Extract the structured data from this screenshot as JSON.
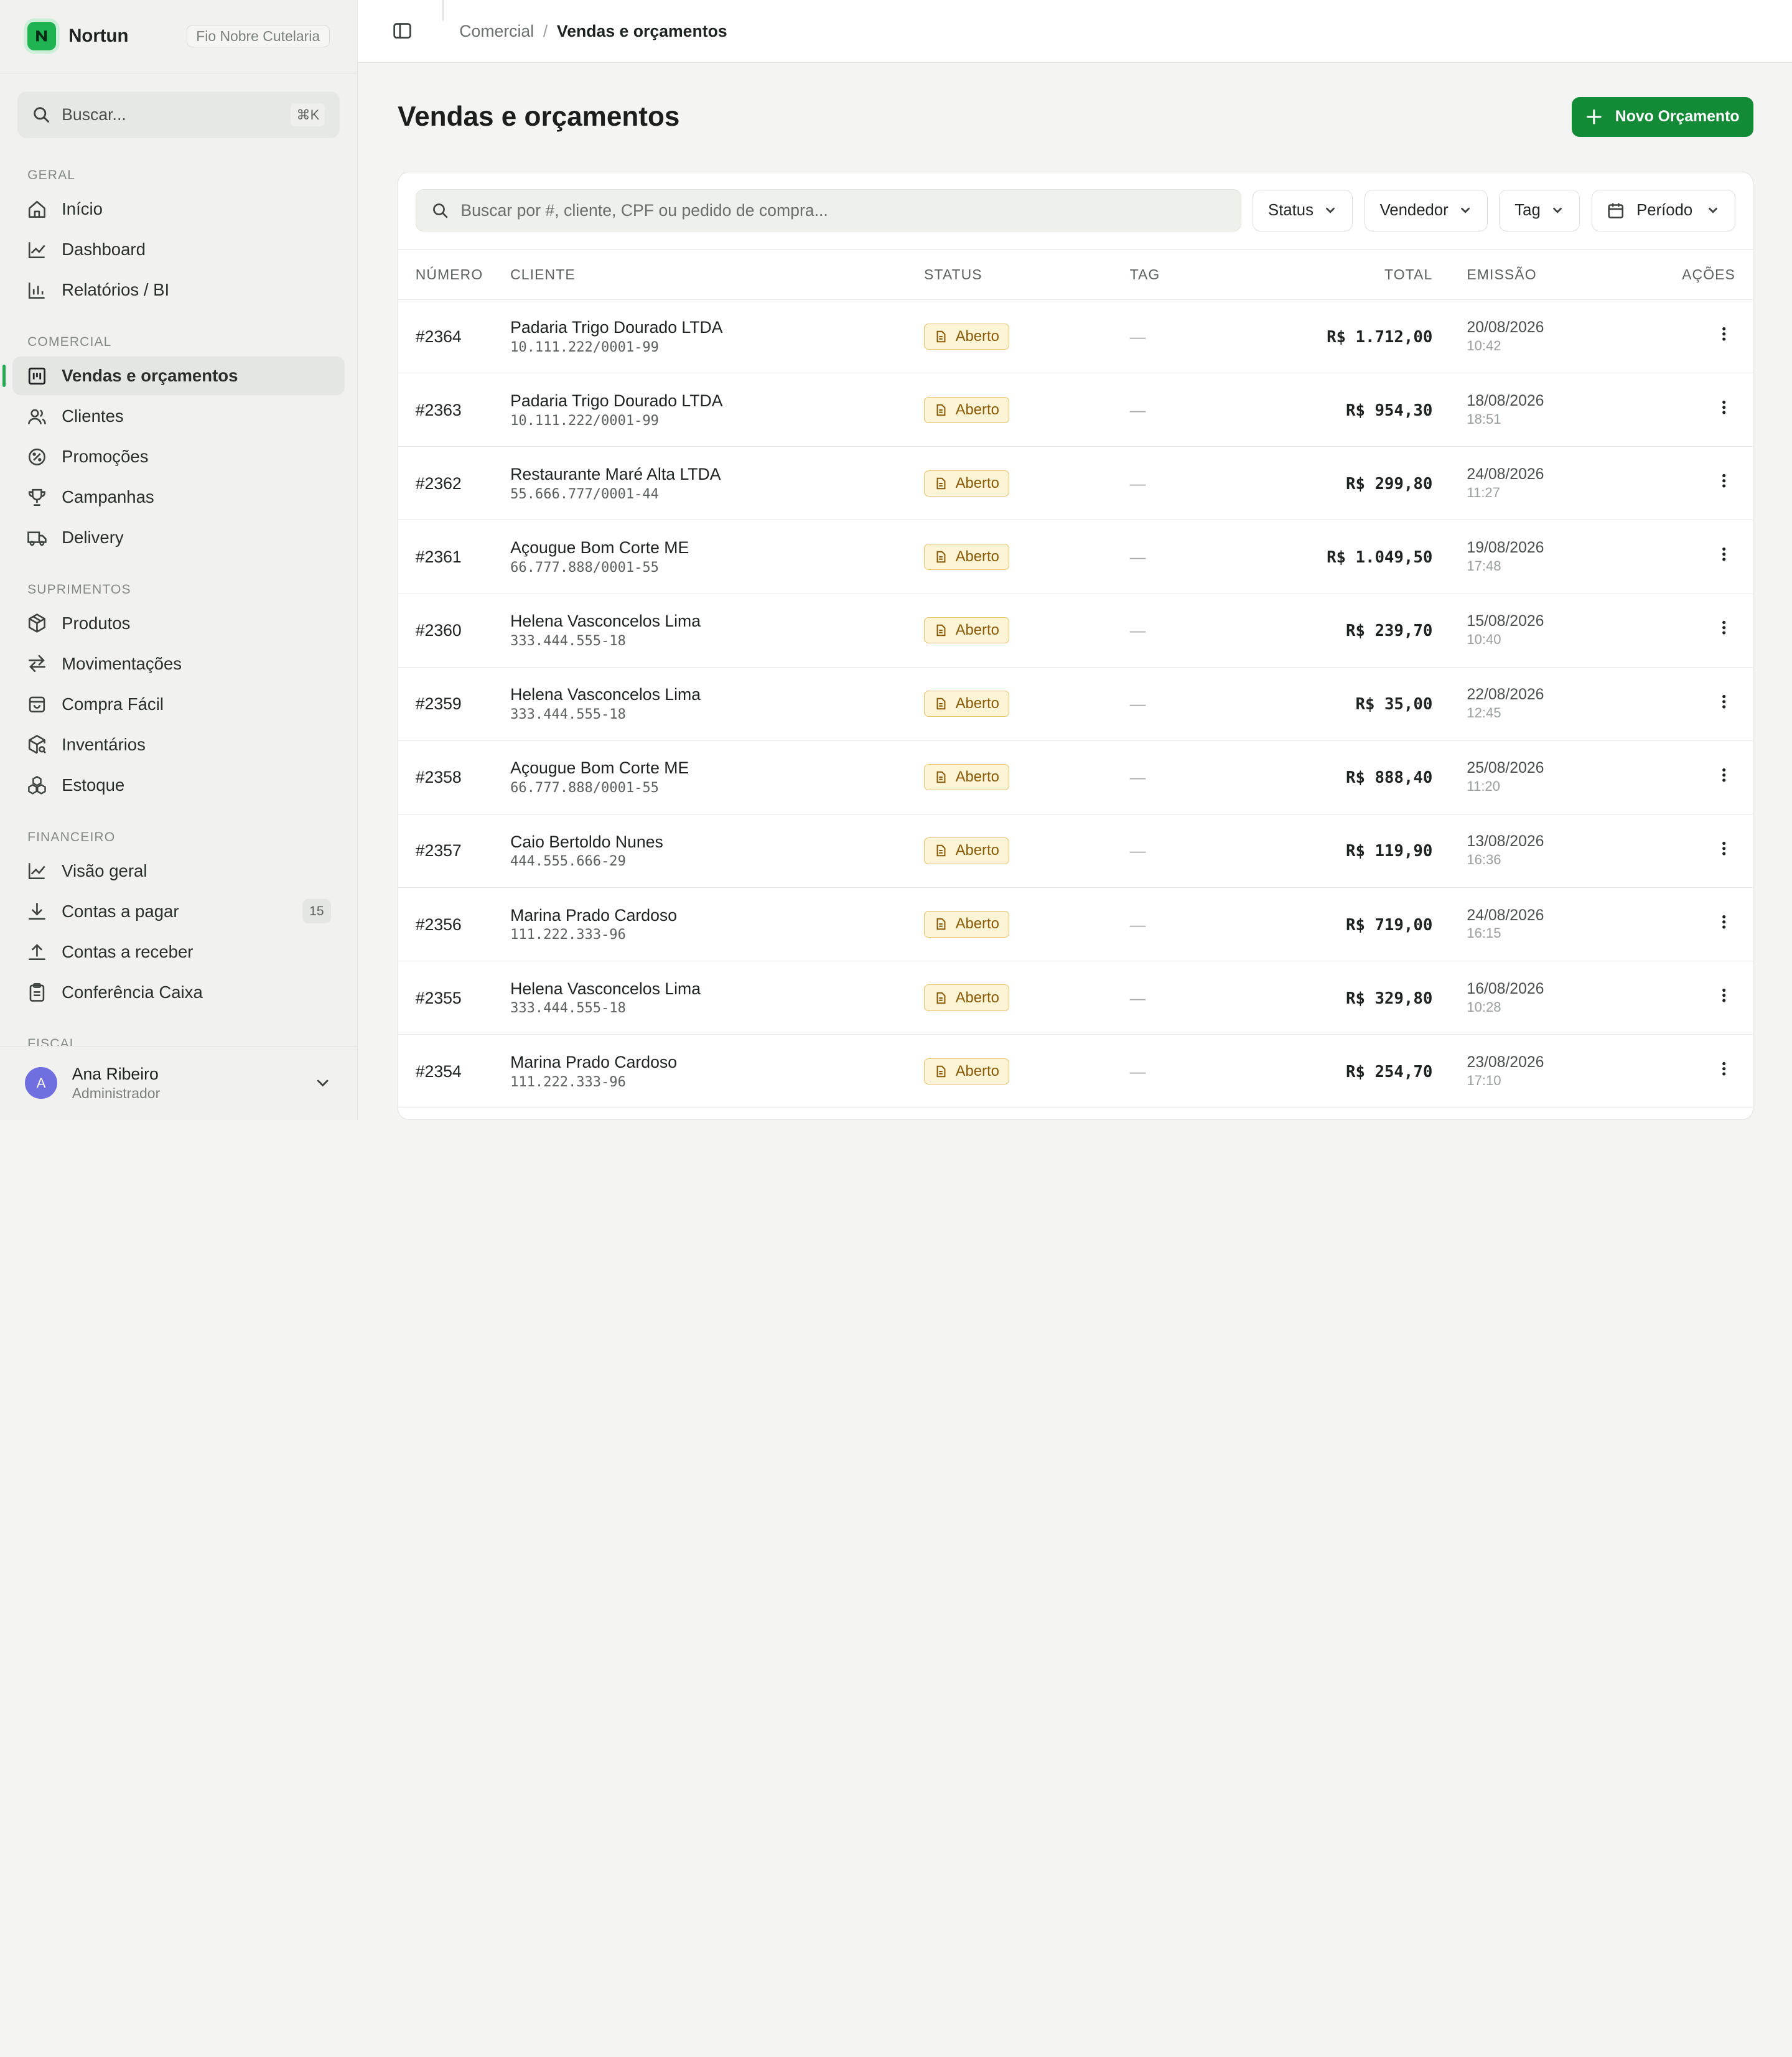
{
  "brand": {
    "name": "Nortun",
    "org": "Fio Nobre Cutelaria"
  },
  "search": {
    "placeholder": "Buscar...",
    "shortcut": "⌘K"
  },
  "nav": {
    "sections": {
      "geral": "GERAL",
      "comercial": "COMERCIAL",
      "suprimentos": "SUPRIMENTOS",
      "financeiro": "FINANCEIRO",
      "fiscal": "FISCAL"
    },
    "items": {
      "inicio": "Início",
      "dashboard": "Dashboard",
      "relatorios": "Relatórios / BI",
      "vendas": "Vendas e orçamentos",
      "clientes": "Clientes",
      "promocoes": "Promoções",
      "campanhas": "Campanhas",
      "delivery": "Delivery",
      "produtos": "Produtos",
      "movimentacoes": "Movimentações",
      "compra_facil": "Compra Fácil",
      "inventarios": "Inventários",
      "estoque": "Estoque",
      "visao_geral": "Visão geral",
      "contas_pagar": "Contas a pagar",
      "contas_pagar_count": "15",
      "contas_receber": "Contas a receber",
      "conferencia_caixa": "Conferência Caixa"
    }
  },
  "user": {
    "initial": "A",
    "name": "Ana Ribeiro",
    "role": "Administrador"
  },
  "breadcrumb": {
    "parent": "Comercial",
    "separator": "/",
    "current": "Vendas e orçamentos"
  },
  "page": {
    "title": "Vendas e orçamentos",
    "new_button": "Novo Orçamento"
  },
  "filters": {
    "search_placeholder": "Buscar por #, cliente, CPF ou pedido de compra...",
    "status": "Status",
    "vendedor": "Vendedor",
    "tag": "Tag",
    "periodo": "Período"
  },
  "table": {
    "headers": {
      "numero": "NÚMERO",
      "cliente": "CLIENTE",
      "status": "STATUS",
      "tag": "TAG",
      "total": "TOTAL",
      "emissao": "EMISSÃO",
      "acoes": "AÇÕES"
    },
    "rows": [
      {
        "num": "#2364",
        "client": "Padaria Trigo Dourado LTDA",
        "doc": "10.111.222/0001-99",
        "status": "Aberto",
        "tag": "—",
        "total": "R$ 1.712,00",
        "date": "20/08/2026",
        "time": "10:42"
      },
      {
        "num": "#2363",
        "client": "Padaria Trigo Dourado LTDA",
        "doc": "10.111.222/0001-99",
        "status": "Aberto",
        "tag": "—",
        "total": "R$ 954,30",
        "date": "18/08/2026",
        "time": "18:51"
      },
      {
        "num": "#2362",
        "client": "Restaurante Maré Alta LTDA",
        "doc": "55.666.777/0001-44",
        "status": "Aberto",
        "tag": "—",
        "total": "R$ 299,80",
        "date": "24/08/2026",
        "time": "11:27"
      },
      {
        "num": "#2361",
        "client": "Açougue Bom Corte ME",
        "doc": "66.777.888/0001-55",
        "status": "Aberto",
        "tag": "—",
        "total": "R$ 1.049,50",
        "date": "19/08/2026",
        "time": "17:48"
      },
      {
        "num": "#2360",
        "client": "Helena Vasconcelos Lima",
        "doc": "333.444.555-18",
        "status": "Aberto",
        "tag": "—",
        "total": "R$ 239,70",
        "date": "15/08/2026",
        "time": "10:40"
      },
      {
        "num": "#2359",
        "client": "Helena Vasconcelos Lima",
        "doc": "333.444.555-18",
        "status": "Aberto",
        "tag": "—",
        "total": "R$ 35,00",
        "date": "22/08/2026",
        "time": "12:45"
      },
      {
        "num": "#2358",
        "client": "Açougue Bom Corte ME",
        "doc": "66.777.888/0001-55",
        "status": "Aberto",
        "tag": "—",
        "total": "R$ 888,40",
        "date": "25/08/2026",
        "time": "11:20"
      },
      {
        "num": "#2357",
        "client": "Caio Bertoldo Nunes",
        "doc": "444.555.666-29",
        "status": "Aberto",
        "tag": "—",
        "total": "R$ 119,90",
        "date": "13/08/2026",
        "time": "16:36"
      },
      {
        "num": "#2356",
        "client": "Marina Prado Cardoso",
        "doc": "111.222.333-96",
        "status": "Aberto",
        "tag": "—",
        "total": "R$ 719,00",
        "date": "24/08/2026",
        "time": "16:15"
      },
      {
        "num": "#2355",
        "client": "Helena Vasconcelos Lima",
        "doc": "333.444.555-18",
        "status": "Aberto",
        "tag": "—",
        "total": "R$ 329,80",
        "date": "16/08/2026",
        "time": "10:28"
      },
      {
        "num": "#2354",
        "client": "Marina Prado Cardoso",
        "doc": "111.222.333-96",
        "status": "Aberto",
        "tag": "—",
        "total": "R$ 254,70",
        "date": "23/08/2026",
        "time": "17:10"
      }
    ]
  },
  "colors": {
    "accent": "#138a36",
    "status_open_bg": "#fdf4d6",
    "status_open_text": "#8a5a06"
  }
}
